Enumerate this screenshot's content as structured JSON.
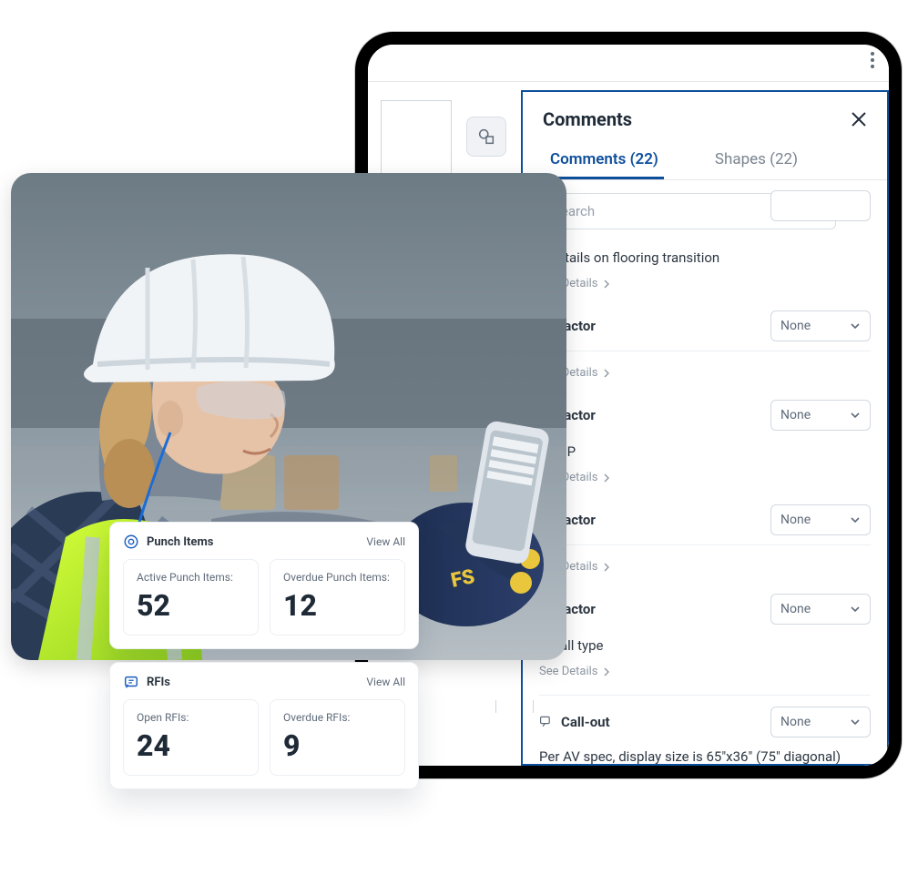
{
  "tablet": {
    "panel_title": "Comments",
    "tabs": [
      {
        "label": "Comments (22)",
        "active": true
      },
      {
        "label": "Shapes (22)",
        "active": false
      }
    ],
    "search": {
      "placeholder": "Search"
    },
    "dropdown_label": "None",
    "see_details": "See Details",
    "items": [
      {
        "title_fragment": "e details on flooring transition",
        "assignee_fragment": "ontractor"
      },
      {
        "title_fragment": "e RCP",
        "assignee_fragment": "ontractor",
        "pre_assignee_fragment": "ontractor"
      },
      {
        "title_fragment": "e wall type",
        "assignee_fragment": "ontractor"
      }
    ],
    "callout": {
      "label": "Call-out",
      "note": "Per AV spec, display size is 65\"x36\" (75\" diagonal)"
    }
  },
  "cards": {
    "punch": {
      "title": "Punch Items",
      "view_all": "View All",
      "metric1": {
        "label": "Active Punch Items:",
        "value": "52"
      },
      "metric2": {
        "label": "Overdue Punch Items:",
        "value": "12"
      }
    },
    "rfi": {
      "title": "RFIs",
      "view_all": "View All",
      "metric1": {
        "label": "Open RFIs:",
        "value": "24"
      },
      "metric2": {
        "label": "Overdue RFIs:",
        "value": "9"
      }
    }
  }
}
